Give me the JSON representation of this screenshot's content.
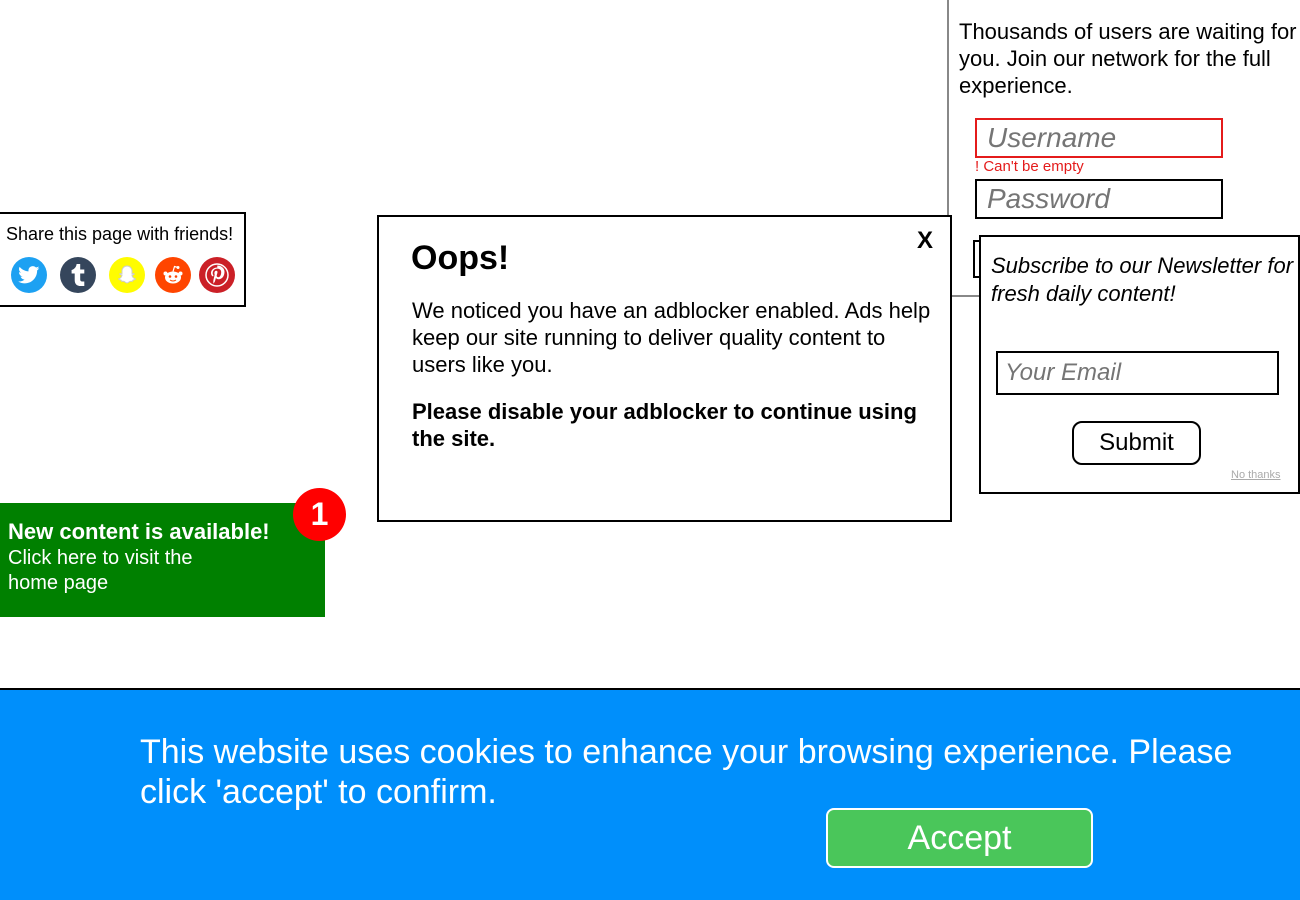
{
  "signup": {
    "text": "Thousands of users are waiting for you. Join our network for the full experience.",
    "username_placeholder": "Username",
    "username_error": "! Can't be empty",
    "password_placeholder": "Password"
  },
  "share": {
    "title": "Share this page with friends!",
    "icons": [
      "twitter-icon",
      "tumblr-icon",
      "snapchat-icon",
      "reddit-icon",
      "pinterest-icon"
    ]
  },
  "adblock_modal": {
    "title": "Oops!",
    "close_label": "X",
    "body": "We noticed you have an adblocker enabled. Ads help keep our site running to deliver quality content to users like you.",
    "strong": "Please disable your adblocker to continue using the site."
  },
  "newsletter": {
    "text": "Subscribe to our Newsletter for fresh daily content!",
    "email_placeholder": "Your Email",
    "submit_label": "Submit",
    "no_thanks_label": "No thanks"
  },
  "notification": {
    "title": "New content is available!",
    "body": "Click here to visit the home page",
    "badge_count": "1"
  },
  "cookie_banner": {
    "text": "This website uses cookies to enhance your browsing experience. Please click 'accept' to confirm.",
    "accept_label": "Accept"
  },
  "colors": {
    "cookie_banner_bg": "#008ffb",
    "accept_button_bg": "#4ac65a",
    "notification_bg": "#008000",
    "badge_bg": "#ff0000",
    "error_red": "#e41b1b"
  }
}
